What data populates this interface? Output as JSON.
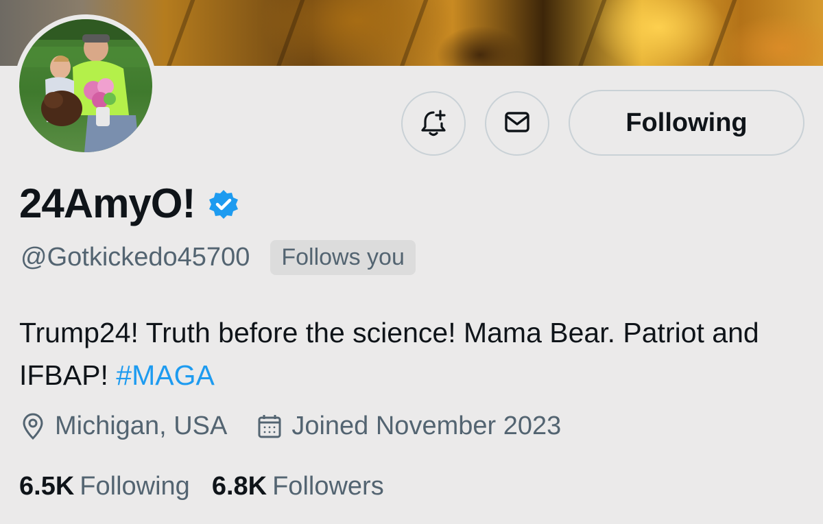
{
  "profile": {
    "display_name": "24AmyO!",
    "verified": true,
    "handle": "@Gotkickedo45700",
    "follows_you_badge": "Follows you",
    "bio_text": "Trump24! Truth before the science! Mama Bear. Patriot and IFBAP! ",
    "bio_hashtag": "#MAGA",
    "location": "Michigan, USA",
    "joined": "Joined November 2023"
  },
  "actions": {
    "notify_icon": "bell-plus-icon",
    "message_icon": "envelope-icon",
    "following_label": "Following"
  },
  "stats": {
    "following_count": "6.5K",
    "following_label": "Following",
    "followers_count": "6.8K",
    "followers_label": "Followers"
  },
  "colors": {
    "background": "#ebeaea",
    "text_primary": "#0f1419",
    "text_secondary": "#536471",
    "accent_blue": "#1d9bf0",
    "button_border": "#c9d1d6"
  }
}
